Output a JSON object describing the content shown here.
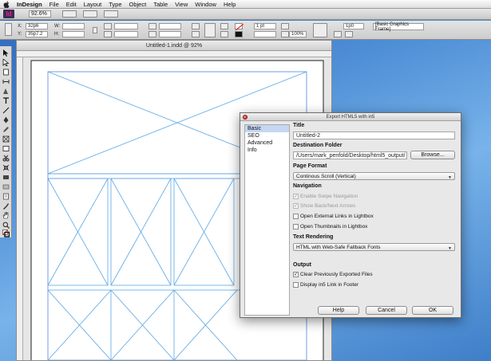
{
  "menubar": {
    "items": [
      {
        "label": "InDesign",
        "bold": true
      },
      {
        "label": "File"
      },
      {
        "label": "Edit"
      },
      {
        "label": "Layout"
      },
      {
        "label": "Type"
      },
      {
        "label": "Object"
      },
      {
        "label": "Table"
      },
      {
        "label": "View"
      },
      {
        "label": "Window"
      },
      {
        "label": "Help"
      }
    ]
  },
  "appbar": {
    "logo": "Id",
    "zoom": "92.6%"
  },
  "control": {
    "x_label": "X:",
    "x_value": "32p6",
    "y_label": "Y:",
    "y_value": "35p7.2",
    "w_label": "W:",
    "h_label": "H:",
    "stroke_weight": "1 pt",
    "scale_value": "100%",
    "gap_value": "1p0",
    "object_style": "[Basic Graphics Frame]"
  },
  "document": {
    "title": "Untitled-1.indd @ 92%"
  },
  "dialog": {
    "title": "Export HTML5 with in5",
    "nav": [
      "Basic",
      "SEO",
      "Advanced",
      "Info"
    ],
    "nav_selected": 0,
    "title_label": "Title",
    "title_value": "Untitled-2",
    "dest_label": "Destination Folder",
    "dest_value": "/Users/mark_penfold/Desktop/html5_output/",
    "browse_label": "Browse...",
    "page_format_label": "Page Format",
    "page_format_value": "Continous Scroll (Vertical)",
    "navigation_label": "Navigation",
    "nav_options": [
      {
        "label": "Enable Swipe Navigation",
        "checked": true,
        "disabled": true
      },
      {
        "label": "Show Back/Next Arrows",
        "checked": true,
        "disabled": true
      },
      {
        "label": "Open External Links in Lightbox",
        "checked": false,
        "disabled": false
      },
      {
        "label": "Open Thumbnails in Lightbox",
        "checked": false,
        "disabled": false
      }
    ],
    "text_rendering_label": "Text Rendering",
    "text_rendering_value": "HTML with Web-Safe Fallback Fonts",
    "output_label": "Output",
    "output_options": [
      {
        "label": "Clear Previously Exported Files",
        "checked": true
      },
      {
        "label": "Display in5 Link in Footer",
        "checked": false
      }
    ],
    "help_label": "Help",
    "cancel_label": "Cancel",
    "ok_label": "OK"
  },
  "colors": {
    "guide": "#5aa7e6",
    "margin": "#c45ad0",
    "selection": "#c5d7f3",
    "desktop": "#4f8fd6"
  }
}
